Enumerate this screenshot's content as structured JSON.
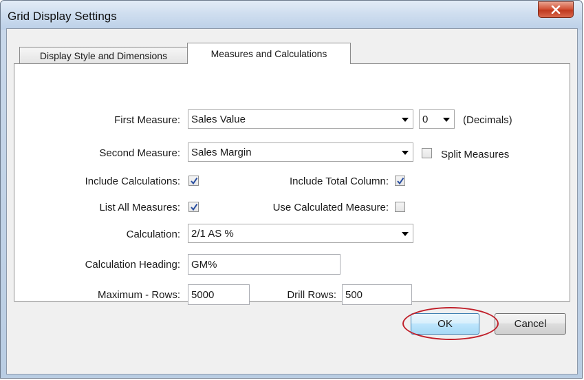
{
  "window": {
    "title": "Grid Display Settings",
    "close_icon": "close-x-icon"
  },
  "tabs": [
    {
      "label": "Display Style and Dimensions",
      "selected": false
    },
    {
      "label": "Measures and Calculations",
      "selected": true
    }
  ],
  "form": {
    "first_measure": {
      "label": "First Measure:",
      "value": "Sales Value"
    },
    "decimals": {
      "value": "0",
      "label": "(Decimals)"
    },
    "second_measure": {
      "label": "Second Measure:",
      "value": "Sales Margin"
    },
    "split_measures": {
      "label": "Split Measures",
      "checked": false
    },
    "include_calculations": {
      "label": "Include Calculations:",
      "checked": true
    },
    "include_total_column": {
      "label": "Include Total Column:",
      "checked": true
    },
    "list_all_measures": {
      "label": "List All Measures:",
      "checked": true
    },
    "use_calculated_measure": {
      "label": "Use Calculated Measure:",
      "checked": false
    },
    "calculation": {
      "label": "Calculation:",
      "value": "2/1 AS %"
    },
    "calculation_heading": {
      "label": "Calculation Heading:",
      "value": "GM%"
    },
    "maximum_rows": {
      "label": "Maximum - Rows:",
      "value": "5000"
    },
    "drill_rows": {
      "label": "Drill Rows:",
      "value": "500"
    }
  },
  "buttons": {
    "ok": "OK",
    "cancel": "Cancel"
  },
  "colors": {
    "highlight_ring": "#c0202a",
    "check": "#2a4fa0"
  }
}
